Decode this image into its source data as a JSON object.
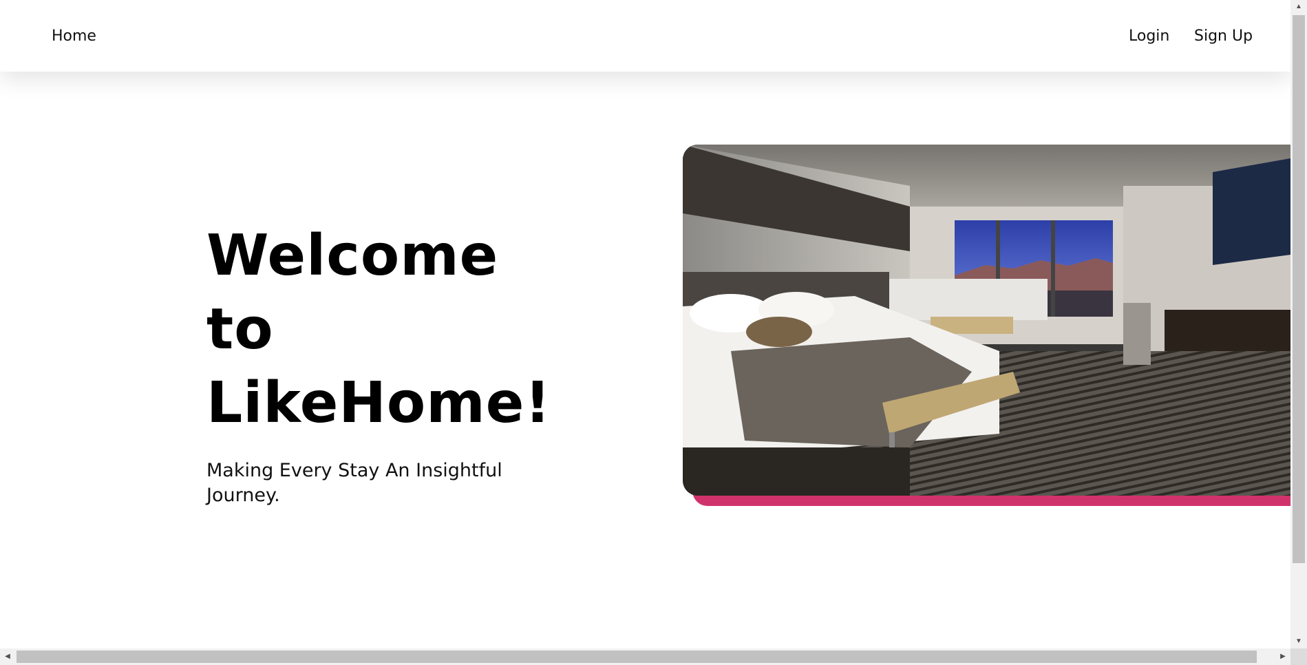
{
  "nav": {
    "home_label": "Home",
    "login_label": "Login",
    "signup_label": "Sign Up"
  },
  "hero": {
    "title_line1": "Welcome",
    "title_line2": "to",
    "title_line3": "LikeHome!",
    "subtitle": "Making Every Stay An Insightful Journey."
  },
  "image": {
    "alt": "Hotel room with two beds and a large window overlooking mountains"
  },
  "colors": {
    "accent": "#d0336c",
    "text": "#111111",
    "background": "#ffffff"
  }
}
